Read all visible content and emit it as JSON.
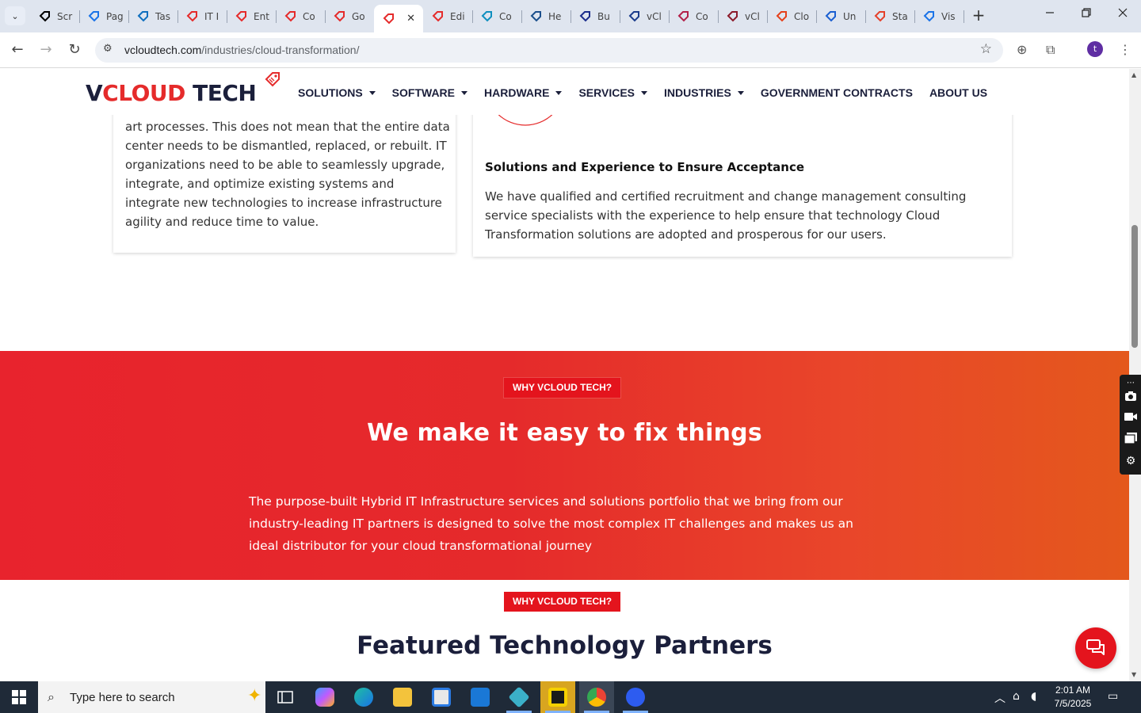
{
  "browser": {
    "tabs": [
      {
        "label": "Scr",
        "icon": "github-icon",
        "color": "#000000"
      },
      {
        "label": "Pag",
        "icon": "gauge-icon",
        "color": "#1a73e8"
      },
      {
        "label": "Tas",
        "icon": "hexagon-icon",
        "color": "#0f6fbf"
      },
      {
        "label": "IT I",
        "icon": "vcloud-icon",
        "color": "#e52b2b"
      },
      {
        "label": "Ent",
        "icon": "vcloud-icon",
        "color": "#e52b2b"
      },
      {
        "label": "Co",
        "icon": "vcloud-icon",
        "color": "#e52b2b"
      },
      {
        "label": "Go",
        "icon": "vcloud-icon",
        "color": "#e52b2b"
      },
      {
        "label": "",
        "icon": "vcloud-icon",
        "color": "#e52b2b",
        "active": true
      },
      {
        "label": "Edi",
        "icon": "vcloud-icon",
        "color": "#e52b2b"
      },
      {
        "label": "Co",
        "icon": "hexagon-icon",
        "color": "#0f8fbf"
      },
      {
        "label": "He",
        "icon": "scale-icon",
        "color": "#1b4f8c"
      },
      {
        "label": "Bu",
        "icon": "x-icon",
        "color": "#1b2d8c"
      },
      {
        "label": "vCl",
        "icon": "check-icon",
        "color": "#1b3c8c"
      },
      {
        "label": "Co",
        "icon": "ball-icon",
        "color": "#b3214a"
      },
      {
        "label": "vCl",
        "icon": "v-icon",
        "color": "#8c1b2b"
      },
      {
        "label": "Clo",
        "icon": "pen-icon",
        "color": "#e5411b"
      },
      {
        "label": "Un",
        "icon": "doc-icon",
        "color": "#1a5fd1"
      },
      {
        "label": "Sta",
        "icon": "feather-icon",
        "color": "#e5412b"
      },
      {
        "label": "Vis",
        "icon": "pulse-icon",
        "color": "#1a73e8"
      }
    ],
    "close_tab": "✕",
    "new_tab": "+",
    "url_host": "vcloudtech.com",
    "url_path": "/industries/cloud-transformation/",
    "profile_initial": "t"
  },
  "site": {
    "logo": {
      "v": "V",
      "cloud": "CLOUD",
      "tech": " TECH"
    },
    "nav": [
      {
        "label": "SOLUTIONS",
        "dropdown": true
      },
      {
        "label": "SOFTWARE",
        "dropdown": true
      },
      {
        "label": "HARDWARE",
        "dropdown": true
      },
      {
        "label": "SERVICES",
        "dropdown": true
      },
      {
        "label": "INDUSTRIES",
        "dropdown": true
      },
      {
        "label": "GOVERNMENT CONTRACTS",
        "dropdown": false
      },
      {
        "label": "ABOUT US",
        "dropdown": false
      }
    ]
  },
  "cards": {
    "left_text": "art processes. This does not mean that the entire data center needs to be dismantled, replaced, or rebuilt. IT organizations need to be able to seamlessly upgrade, integrate, and optimize existing systems and integrate new technologies to increase infrastructure agility and reduce time to value.",
    "right_title": "Solutions and Experience to Ensure Acceptance",
    "right_text": "We have qualified and certified recruitment and change management consulting service specialists with the experience to help ensure that technology Cloud Transformation solutions are adopted and prosperous for our users."
  },
  "why": {
    "badge": "WHY VCLOUD TECH?",
    "title": "We make it easy to fix things",
    "text": "The purpose-built Hybrid IT Infrastructure services and solutions portfolio that we bring from our industry-leading IT partners is designed to solve the most complex IT challenges and makes us an ideal distributor for your cloud transformational journey"
  },
  "partners": {
    "badge": "WHY VCLOUD TECH?",
    "title": "Featured Technology Partners"
  },
  "colors": {
    "brand_red": "#e52b2b",
    "navy": "#1b1f3b"
  },
  "taskbar": {
    "search_placeholder": "Type here to search",
    "time": "2:01 AM",
    "date": "7/5/2025"
  }
}
